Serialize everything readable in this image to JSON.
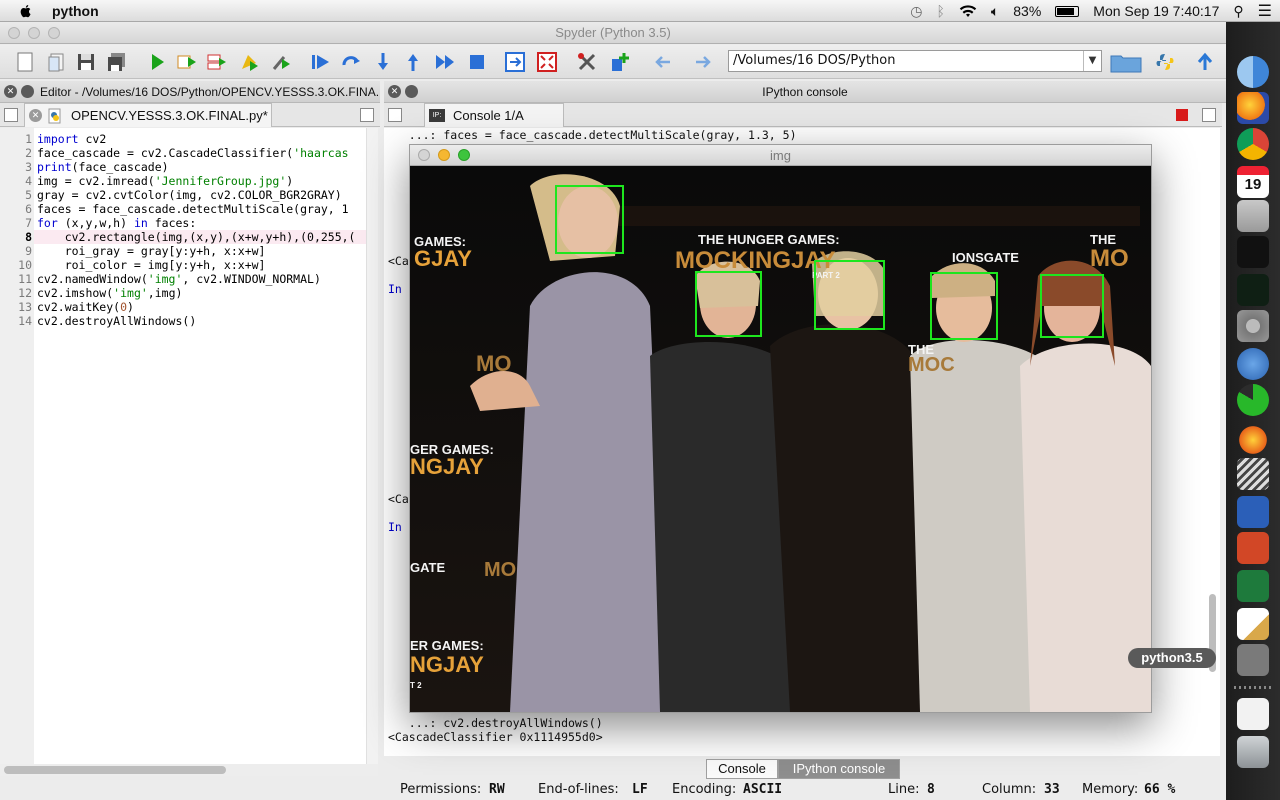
{
  "menubar": {
    "app_name": "python",
    "battery": "83%",
    "datetime": "Mon Sep 19  7:40:17"
  },
  "window": {
    "title": "Spyder (Python 3.5)"
  },
  "toolbar": {
    "path": "/Volumes/16 DOS/Python"
  },
  "editor": {
    "pane_title": "Editor - /Volumes/16 DOS/Python/OPENCV.YESSS.3.OK.FINA...",
    "tab_label": "OPENCV.YESSS.3.OK.FINAL.py*",
    "current_line": 8,
    "lines": [
      "import cv2",
      "face_cascade = cv2.CascadeClassifier('haarcas",
      "print(face_cascade)",
      "img = cv2.imread('JenniferGroup.jpg')",
      "gray = cv2.cvtColor(img, cv2.COLOR_BGR2GRAY)",
      "faces = face_cascade.detectMultiScale(gray, 1",
      "for (x,y,w,h) in faces:",
      "    cv2.rectangle(img,(x,y),(x+w,y+h),(0,255,(",
      "    roi_gray = gray[y:y+h, x:x+w]",
      "    roi_color = img[y:y+h, x:x+w]",
      "cv2.namedWindow('img', cv2.WINDOW_NORMAL)",
      "cv2.imshow('img',img)",
      "cv2.waitKey(0)",
      "cv2.destroyAllWindows()"
    ],
    "line_numbers": [
      "1",
      "2",
      "3",
      "4",
      "5",
      "6",
      "7",
      "8",
      "9",
      "10",
      "11",
      "12",
      "13",
      "14"
    ]
  },
  "console": {
    "pane_title": "IPython console",
    "tab_label": "Console 1/A",
    "line_top": "   ...: faces = face_cascade.detectMultiScale(gray, 1.3, 5)",
    "frag_1": "<Ca",
    "frag_2": "In",
    "frag_3": "<Ca",
    "frag_4": "In",
    "line_bottom_1": "   ...: cv2.destroyAllWindows()",
    "line_bottom_2": "<CascadeClassifier 0x1114955d0>",
    "bottom_tabs": [
      "Console",
      "IPython console"
    ]
  },
  "image_window": {
    "title": "img",
    "signage": {
      "games_1": "GAMES:",
      "gjay_1": "GJAY",
      "hunger": "THE HUNGER GAMES:",
      "mocking": "MOCKINGJAY",
      "part2": "PART 2",
      "lionsgate": "IONSGATE",
      "mo_1": "MO",
      "the_1": "THE",
      "mo_2": "MO",
      "games_2": "GER GAMES:",
      "ngjay_2": "NGJAY",
      "gate": "GATE",
      "mo_3": "MO",
      "games_3": "ER GAMES:",
      "ngjay_3": "NGJAY",
      "t2": "T 2",
      "the_2": "THE",
      "mo_4": "MOC"
    }
  },
  "statusbar": {
    "permissions_label": "Permissions:",
    "permissions": "RW",
    "eol_label": "End-of-lines:",
    "eol": "LF",
    "encoding_label": "Encoding:",
    "encoding": "ASCII",
    "line_label": "Line:",
    "line": "8",
    "column_label": "Column:",
    "column": "33",
    "memory_label": "Memory:",
    "memory": "66 %"
  },
  "dock": {
    "tooltip": "python3.5",
    "calendar_day": "19",
    "icons": [
      "finder-icon",
      "firefox-icon",
      "chrome-icon",
      "calendar-icon",
      "calculator-icon",
      "terminal-icon",
      "activity-monitor-icon",
      "system-preferences-icon",
      "r-icon",
      "spinner-icon",
      "burst-icon",
      "stack-icon",
      "word-icon",
      "powerpoint-icon",
      "excel-icon",
      "textedit-icon",
      "python-window-icon",
      "document-icon",
      "trash-icon"
    ]
  },
  "colors": {
    "face_box": "#1ee61e",
    "keyword": "#0000d0",
    "string": "#008000",
    "number": "#a0522d"
  }
}
